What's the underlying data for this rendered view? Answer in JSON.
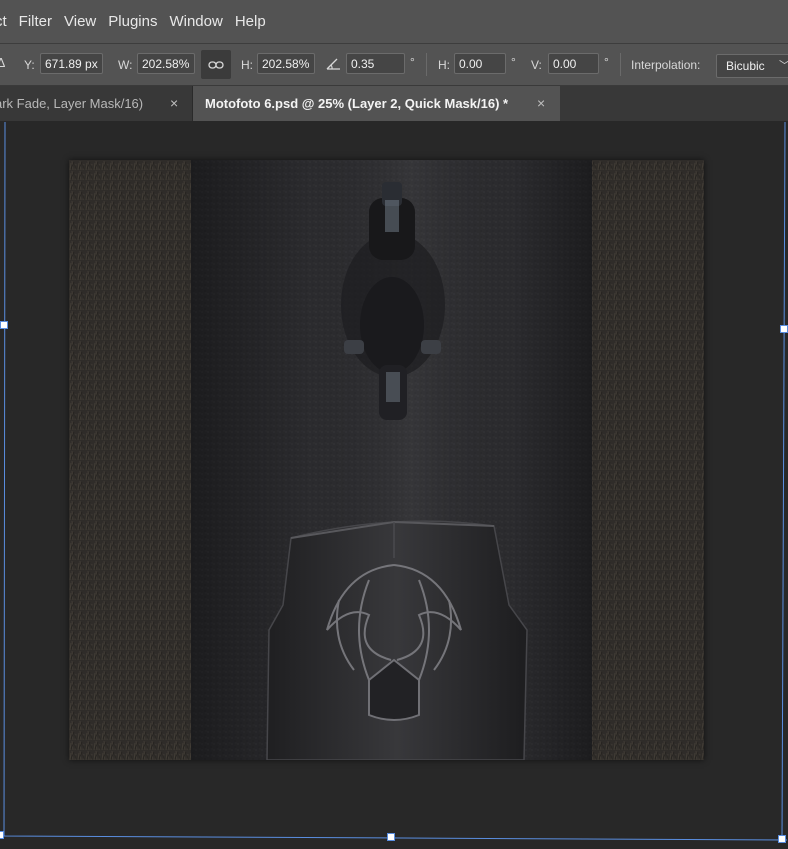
{
  "menubar": {
    "items": [
      "ct",
      "Filter",
      "View",
      "Plugins",
      "Window",
      "Help"
    ]
  },
  "options": {
    "y_label": "Y:",
    "y_value": "671.89 px",
    "w_label": "W:",
    "w_value": "202.58%",
    "h_label": "H:",
    "h_value": "202.58%",
    "angle_value": "0.35",
    "degree_symbol": "°",
    "skew_h_label": "H:",
    "skew_h_value": "0.00",
    "skew_v_label": "V:",
    "skew_v_value": "0.00",
    "interpolation_label": "Interpolation:",
    "interpolation_value": "Bicubic"
  },
  "tabs": [
    {
      "title": "ark Fade, Layer Mask/16)",
      "active": false
    },
    {
      "title": "Motofoto 6.psd @ 25% (Layer 2, Quick Mask/16) *",
      "active": true
    }
  ],
  "tab_close_glyph": "×",
  "colors": {
    "chrome": "#535353",
    "canvas_bg": "#282828",
    "transform_bbox": "#5a8ee0"
  },
  "icons": {
    "reference_point": "reference-point-icon",
    "link": "link-icon",
    "angle": "angle-icon",
    "dropdown": "chevron-down-icon",
    "close": "close-icon"
  }
}
